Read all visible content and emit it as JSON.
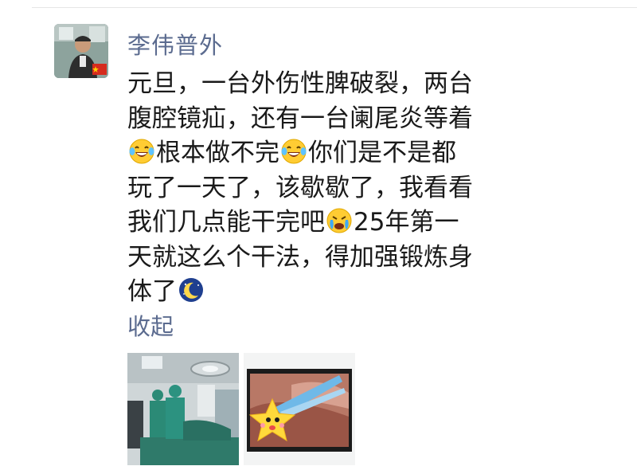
{
  "post": {
    "author": "李伟普外",
    "segments": [
      {
        "type": "text",
        "value": "元旦，一台外伤性脾破裂，两台腹腔镜疝，还有一台阑尾炎等着"
      },
      {
        "type": "emoji",
        "icon": "tears-of-joy-emoji"
      },
      {
        "type": "text",
        "value": "根本做不完"
      },
      {
        "type": "emoji",
        "icon": "tears-of-joy-emoji"
      },
      {
        "type": "text",
        "value": "你们是不是都玩了一天了，该歇歇了，我看看我们几点能干完吧"
      },
      {
        "type": "emoji",
        "icon": "crying-face-emoji"
      },
      {
        "type": "text",
        "value": "25年第一天就这么个干法，得加强锻炼身体了"
      },
      {
        "type": "emoji",
        "icon": "moon-night-emoji"
      }
    ],
    "collapse_label": "收起"
  },
  "images": [
    {
      "icon": "operating-room-photo"
    },
    {
      "icon": "surgical-monitor-photo"
    }
  ],
  "colors": {
    "name_link": "#5b6b8f",
    "text": "#1a1a1a",
    "background": "#ffffff"
  }
}
